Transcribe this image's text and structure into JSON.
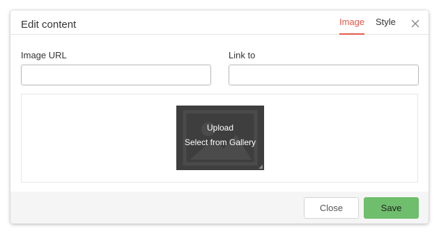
{
  "dialog": {
    "title": "Edit content",
    "tabs": [
      {
        "label": "Image",
        "active": true
      },
      {
        "label": "Style",
        "active": false
      }
    ],
    "close_icon": "close-icon"
  },
  "fields": {
    "image_url": {
      "label": "Image URL",
      "value": "",
      "placeholder": ""
    },
    "link_to": {
      "label": "Link to",
      "value": "",
      "placeholder": ""
    }
  },
  "image_area": {
    "upload_label": "Upload",
    "gallery_label": "Select from Gallery",
    "placeholder_icon": "image-placeholder-icon",
    "resize_icon": "resize-handle-icon"
  },
  "footer": {
    "close_label": "Close",
    "save_label": "Save"
  },
  "colors": {
    "accent": "#e5564a",
    "save_button": "#6fbe6d",
    "image_box": "#3e3e3e",
    "footer_bg": "#f5f5f5"
  }
}
